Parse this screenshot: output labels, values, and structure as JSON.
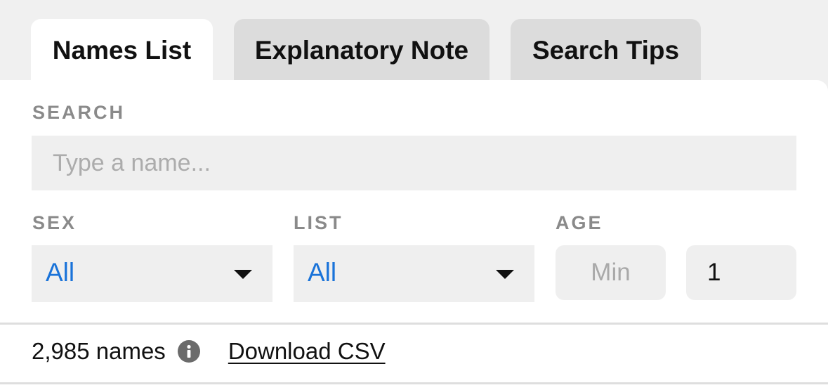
{
  "tabs": [
    {
      "label": "Names List",
      "active": true
    },
    {
      "label": "Explanatory Note",
      "active": false
    },
    {
      "label": "Search Tips",
      "active": false
    }
  ],
  "search": {
    "label": "SEARCH",
    "value": "",
    "placeholder": "Type a name..."
  },
  "filters": {
    "sex": {
      "label": "SEX",
      "selected": "All"
    },
    "list": {
      "label": "LIST",
      "selected": "All"
    },
    "age": {
      "label": "AGE",
      "min": {
        "value": "",
        "placeholder": "Min"
      },
      "max": {
        "value": "1",
        "placeholder": ""
      }
    }
  },
  "footer": {
    "count_text": "2,985 names",
    "info_icon": "info-icon",
    "download_label": "Download CSV"
  },
  "colors": {
    "accent": "#1a73d9",
    "page_background": "#f0f0f0",
    "active_tab": "#ffffff",
    "inactive_tab": "#dcdcdc",
    "label_gray": "#8a8a8a",
    "field_background": "#efefef"
  }
}
